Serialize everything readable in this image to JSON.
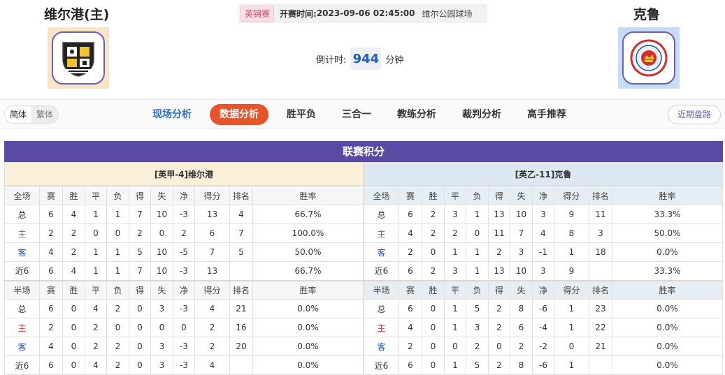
{
  "header": {
    "home_team": "维尔港(主)",
    "away_team": "克鲁",
    "league": "英锦赛",
    "kickoff_label": "开赛时间:",
    "kickoff_time": "2023-09-06 02:45:00",
    "venue": "维尔公园球场",
    "countdown_label": "倒计时:",
    "countdown_value": "944",
    "countdown_unit": "分钟",
    "home_logo_icon": "port-vale-crest-icon",
    "away_logo_icon": "crewe-alexandra-crest-icon"
  },
  "nav": {
    "lang_simplified": "简体",
    "lang_traditional": "繁体",
    "tabs": [
      {
        "label": "现场分析"
      },
      {
        "label": "数据分析"
      },
      {
        "label": "胜平负"
      },
      {
        "label": "三合一"
      },
      {
        "label": "教练分析"
      },
      {
        "label": "裁判分析"
      },
      {
        "label": "高手推荐"
      }
    ],
    "recent_button": "近期盘路"
  },
  "standings": {
    "title": "联赛积分",
    "home": {
      "title": "[英甲-4]维尔港",
      "full": {
        "headers": [
          "全场",
          "赛",
          "胜",
          "平",
          "负",
          "得",
          "失",
          "净",
          "得分",
          "排名",
          "胜率"
        ],
        "rows": [
          [
            "总",
            "6",
            "4",
            "1",
            "1",
            "7",
            "10",
            "-3",
            "13",
            "4",
            "66.7%"
          ],
          [
            "主",
            "2",
            "2",
            "0",
            "0",
            "2",
            "0",
            "2",
            "6",
            "7",
            "100.0%"
          ],
          [
            "客",
            "4",
            "2",
            "1",
            "1",
            "5",
            "10",
            "-5",
            "7",
            "5",
            "50.0%"
          ],
          [
            "近6",
            "6",
            "4",
            "1",
            "1",
            "7",
            "10",
            "-3",
            "13",
            "",
            "66.7%"
          ]
        ]
      },
      "half": {
        "headers": [
          "半场",
          "赛",
          "胜",
          "平",
          "负",
          "得",
          "失",
          "净",
          "得分",
          "排名",
          "胜率"
        ],
        "rows": [
          [
            "总",
            "6",
            "0",
            "4",
            "2",
            "0",
            "3",
            "-3",
            "4",
            "21",
            "0.0%"
          ],
          [
            "主",
            "2",
            "0",
            "2",
            "0",
            "0",
            "0",
            "0",
            "2",
            "16",
            "0.0%"
          ],
          [
            "客",
            "4",
            "0",
            "2",
            "2",
            "0",
            "3",
            "-3",
            "2",
            "20",
            "0.0%"
          ],
          [
            "近6",
            "6",
            "0",
            "4",
            "2",
            "0",
            "3",
            "-3",
            "4",
            "",
            "0.0%"
          ]
        ]
      }
    },
    "away": {
      "title": "[英乙-11]克鲁",
      "full": {
        "headers": [
          "全场",
          "赛",
          "胜",
          "平",
          "负",
          "得",
          "失",
          "净",
          "得分",
          "排名",
          "胜率"
        ],
        "rows": [
          [
            "总",
            "6",
            "2",
            "3",
            "1",
            "13",
            "10",
            "3",
            "9",
            "11",
            "33.3%"
          ],
          [
            "主",
            "4",
            "2",
            "2",
            "0",
            "11",
            "7",
            "4",
            "8",
            "3",
            "50.0%"
          ],
          [
            "客",
            "2",
            "0",
            "1",
            "1",
            "2",
            "3",
            "-1",
            "1",
            "18",
            "0.0%"
          ],
          [
            "近6",
            "6",
            "2",
            "3",
            "1",
            "13",
            "10",
            "3",
            "9",
            "",
            "33.3%"
          ]
        ]
      },
      "half": {
        "headers": [
          "半场",
          "赛",
          "胜",
          "平",
          "负",
          "得",
          "失",
          "净",
          "得分",
          "排名",
          "胜率"
        ],
        "rows": [
          [
            "总",
            "6",
            "0",
            "1",
            "5",
            "2",
            "8",
            "-6",
            "1",
            "23",
            "0.0%"
          ],
          [
            "主",
            "4",
            "0",
            "1",
            "3",
            "2",
            "6",
            "-4",
            "1",
            "22",
            "0.0%"
          ],
          [
            "客",
            "2",
            "0",
            "0",
            "2",
            "0",
            "2",
            "-2",
            "0",
            "21",
            "0.0%"
          ],
          [
            "近6",
            "6",
            "0",
            "1",
            "5",
            "2",
            "8",
            "-6",
            "1",
            "",
            "0.0%"
          ]
        ]
      }
    }
  }
}
